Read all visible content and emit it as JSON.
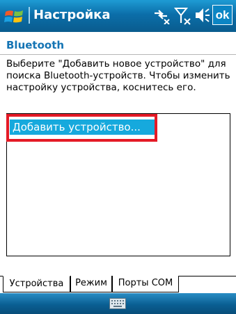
{
  "titlebar": {
    "title": "Настройка",
    "ok_label": "ok",
    "icons": [
      "windows-start-icon",
      "connectivity-icon",
      "signal-off-icon",
      "volume-icon"
    ]
  },
  "header": {
    "title": "Bluetooth"
  },
  "instructions": "Выберите \"Добавить новое устройство\" для поиска Bluetooth-устройств. Чтобы изменить настройку устройства, коснитесь его.",
  "device_list": {
    "items": [
      {
        "label": "Добавить устройство...",
        "selected": true
      }
    ]
  },
  "tabs": [
    {
      "label": "Устройства",
      "active": true
    },
    {
      "label": "Режим",
      "active": false
    },
    {
      "label": "Порты COM",
      "active": false
    }
  ],
  "menubar": {
    "center_icon": "keyboard-icon"
  },
  "colors": {
    "titlebar": "#0b6ea9",
    "header_text": "#1474b4",
    "selection": "#16a9dd",
    "highlight": "#e41a26"
  }
}
